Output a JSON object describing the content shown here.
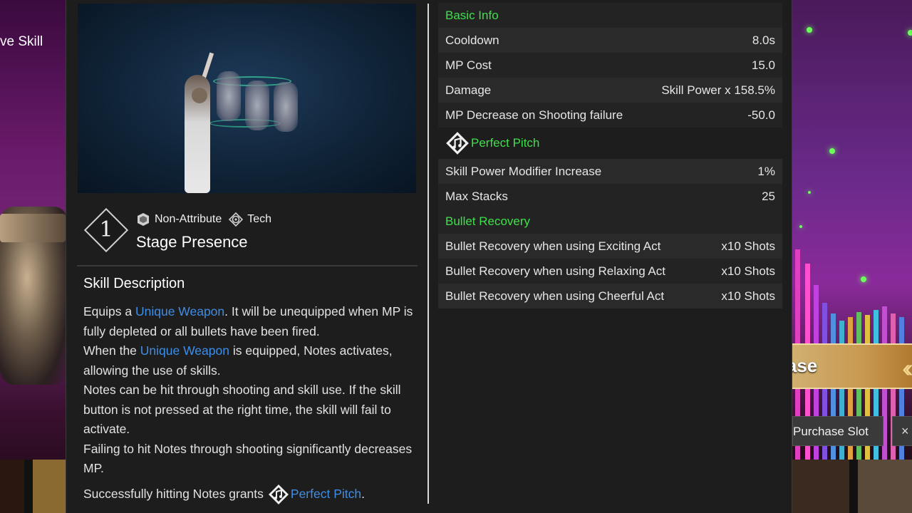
{
  "background": {
    "left_skill_label": "ve Skill",
    "purchase_banner": "hase",
    "purchase_slot_button": "Purchase Slot",
    "slot_close_glyph": "×"
  },
  "skill": {
    "level": "1",
    "tags": [
      {
        "label": "Non-Attribute",
        "icon": "non-attribute-icon"
      },
      {
        "label": "Tech",
        "icon": "tech-icon"
      }
    ],
    "name": "Stage Presence"
  },
  "description": {
    "title": "Skill Description",
    "p1_a": "Equips a ",
    "p1_link": "Unique Weapon",
    "p1_b": ". It will be unequipped when MP is fully depleted or all bullets have been fired.",
    "p2_a": "When the ",
    "p2_link": "Unique Weapon",
    "p2_b": " is equipped, Notes activates, allowing the use of skills.",
    "p3": "Notes can be hit through shooting and skill use. If the skill button is not pressed at the right time, the skill will fail to activate.",
    "p4": "Failing to hit Notes through shooting significantly decreases MP.",
    "p5_a": "Successfully hitting Notes grants ",
    "p5_link": "Perfect Pitch",
    "p5_b": "."
  },
  "stats": {
    "basic_info": "Basic Info",
    "rows_basic": [
      {
        "label": "Cooldown",
        "value": "8.0s"
      },
      {
        "label": "MP Cost",
        "value": "15.0"
      },
      {
        "label": "Damage",
        "value": "Skill Power x 158.5%"
      },
      {
        "label": "MP Decrease on Shooting failure",
        "value": "-50.0"
      }
    ],
    "perfect_pitch": "Perfect Pitch",
    "rows_pitch": [
      {
        "label": "Skill Power Modifier Increase",
        "value": "1%"
      },
      {
        "label": "Max Stacks",
        "value": "25"
      }
    ],
    "bullet_recovery": "Bullet Recovery",
    "rows_bullet": [
      {
        "label": "Bullet Recovery when using Exciting Act",
        "value": "x10 Shots"
      },
      {
        "label": "Bullet Recovery when using Relaxing Act",
        "value": "x10 Shots"
      },
      {
        "label": "Bullet Recovery when using Cheerful Act",
        "value": "x10 Shots"
      }
    ]
  },
  "colors": {
    "section_green": "#3ee04a",
    "link_blue": "#3d8ee8",
    "panel_bg": "#1d1d1d"
  }
}
